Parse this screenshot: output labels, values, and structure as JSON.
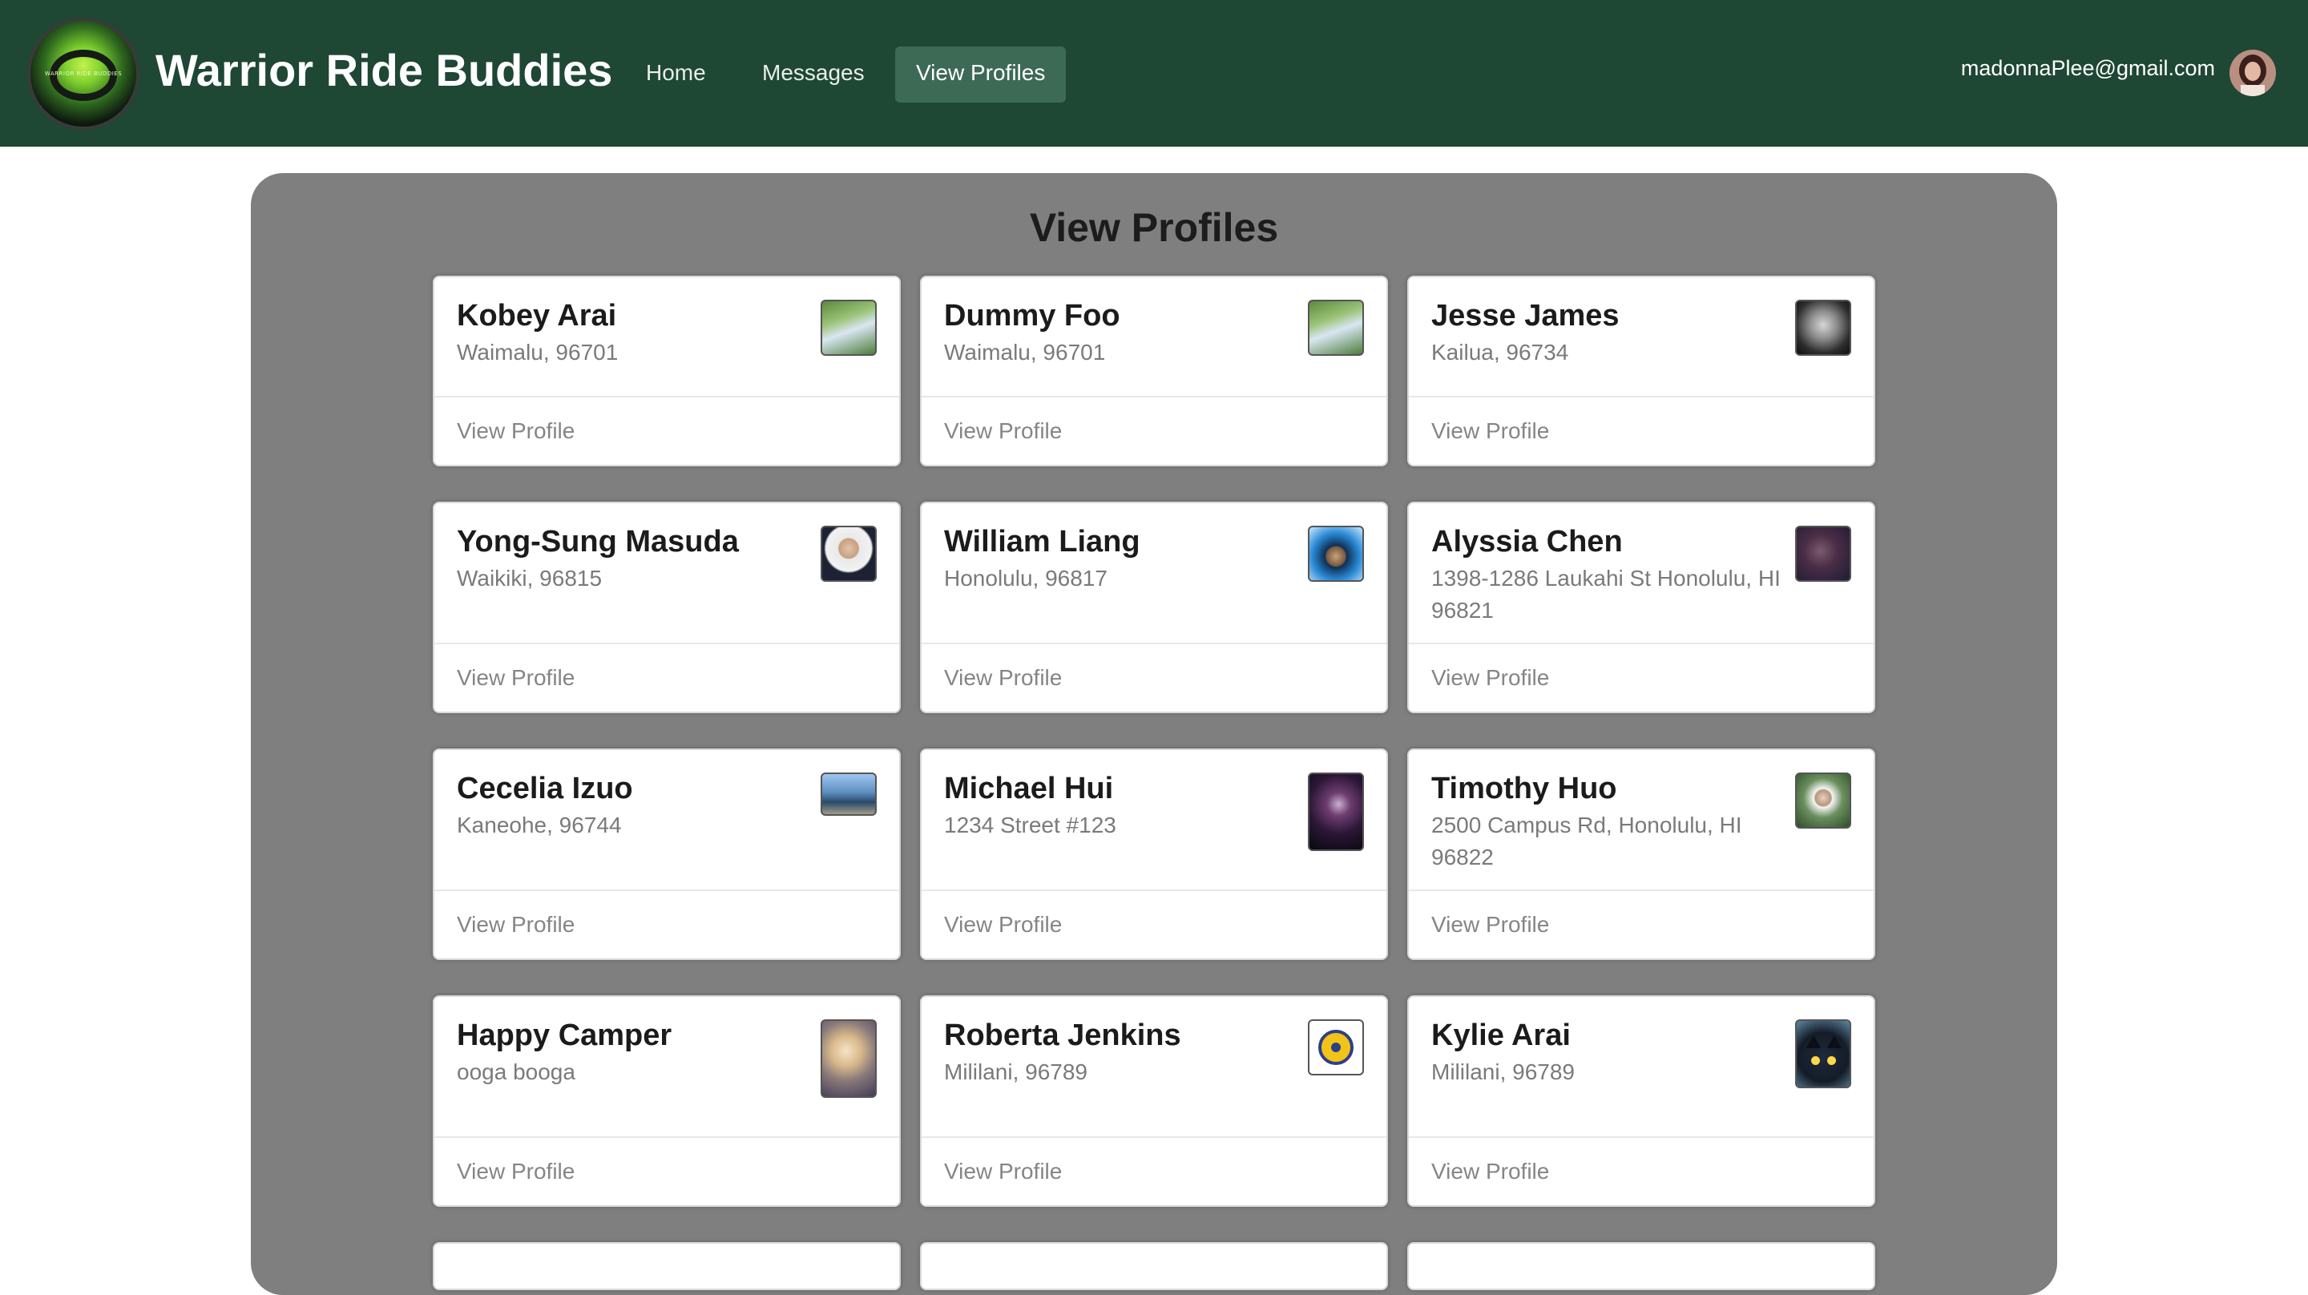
{
  "app": {
    "brand": "Warrior Ride Buddies",
    "logo_text": "WARRIOR RIDE BUDDIES"
  },
  "nav": {
    "home": "Home",
    "messages": "Messages",
    "view_profiles": "View Profiles",
    "active": "View Profiles"
  },
  "user": {
    "email": "madonnaPlee@gmail.com",
    "avatar_icon": "user-avatar"
  },
  "page": {
    "title": "View Profiles"
  },
  "profiles": [
    {
      "name": "Kobey Arai",
      "address": "Waimalu, 96701",
      "link": "View Profile",
      "photo": "green-outdoor-photo"
    },
    {
      "name": "Dummy Foo",
      "address": "Waimalu, 96701",
      "link": "View Profile",
      "photo": "green-outdoor-photo"
    },
    {
      "name": "Jesse James",
      "address": "Kailua, 96734",
      "link": "View Profile",
      "photo": "bw-portrait-photo"
    },
    {
      "name": "Yong-Sung Masuda",
      "address": "Waikiki, 96815",
      "link": "View Profile",
      "photo": "suit-portrait-photo"
    },
    {
      "name": "William Liang",
      "address": "Honolulu, 96817",
      "link": "View Profile",
      "photo": "palm-selfie-photo"
    },
    {
      "name": "Alyssia Chen",
      "address": "1398-1286 Laukahi St Honolulu, HI 96821",
      "link": "View Profile",
      "photo": "purple-portrait-photo"
    },
    {
      "name": "Cecelia Izuo",
      "address": "Kaneohe, 96744",
      "link": "View Profile",
      "photo": "beach-photo"
    },
    {
      "name": "Michael Hui",
      "address": "1234 Street #123",
      "link": "View Profile",
      "photo": "dark-character-photo"
    },
    {
      "name": "Timothy Huo",
      "address": "2500 Campus Rd, Honolulu, HI 96822",
      "link": "View Profile",
      "photo": "forest-portrait-photo"
    },
    {
      "name": "Happy Camper",
      "address": "ooga booga",
      "link": "View Profile",
      "photo": "blonde-character-photo"
    },
    {
      "name": "Roberta Jenkins",
      "address": "Mililani, 96789",
      "link": "View Profile",
      "photo": "lions-logo"
    },
    {
      "name": "Kylie Arai",
      "address": "Mililani, 96789",
      "link": "View Profile",
      "photo": "black-cat-photo"
    }
  ]
}
